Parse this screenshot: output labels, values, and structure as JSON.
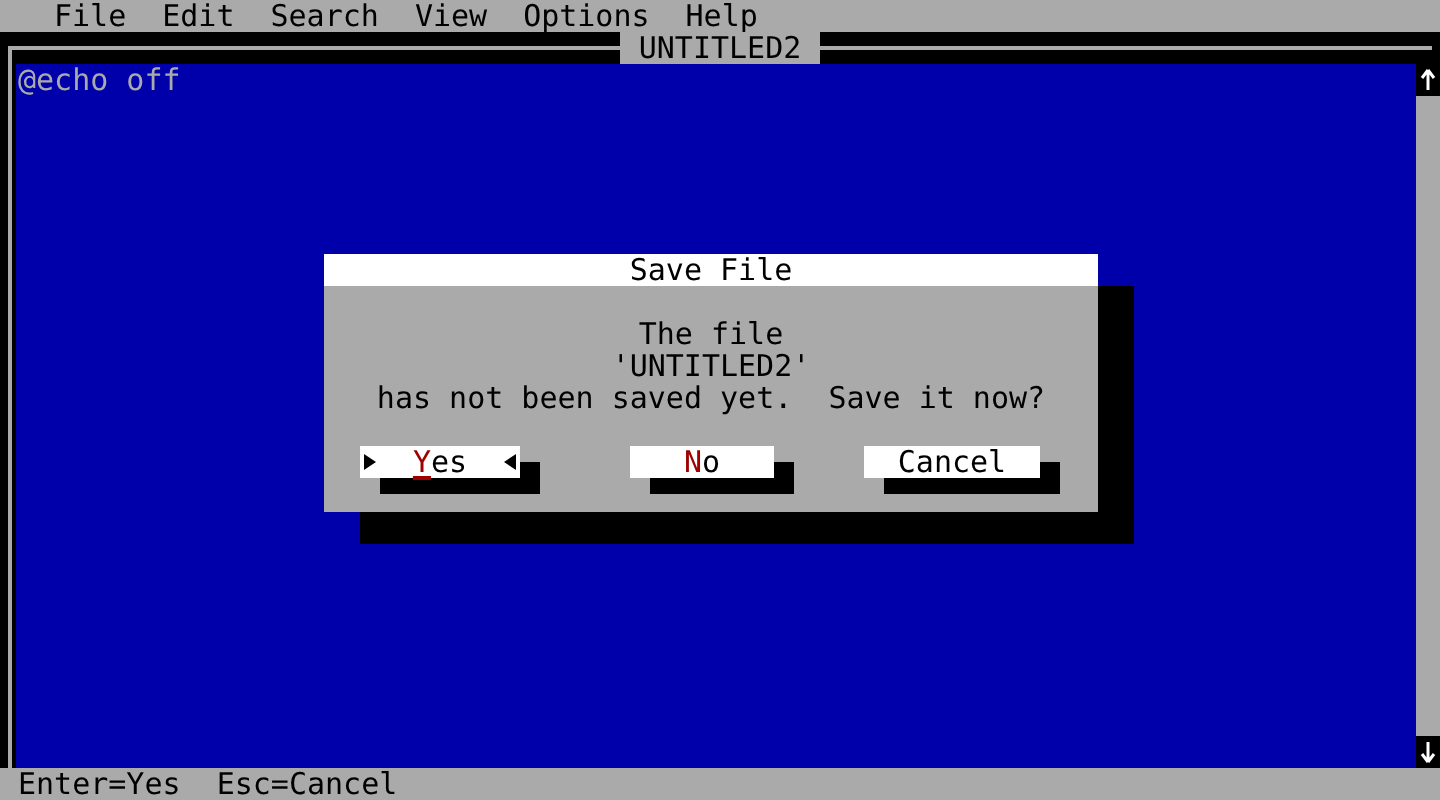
{
  "menu": [
    "File",
    "Edit",
    "Search",
    "View",
    "Options",
    "Help"
  ],
  "editor": {
    "title": "UNTITLED2",
    "lines": [
      "@echo off"
    ]
  },
  "dialog": {
    "title": "Save File",
    "message": [
      "The file",
      "'UNTITLED2'",
      "has not been saved yet.  Save it now?"
    ],
    "buttons": [
      {
        "label": "Yes",
        "selected": true,
        "hotkey": true
      },
      {
        "label": "No",
        "selected": false,
        "hotkey": true
      },
      {
        "label": "Cancel",
        "selected": false,
        "hotkey": false
      }
    ]
  },
  "status_bar": "Enter=Yes  Esc=Cancel"
}
